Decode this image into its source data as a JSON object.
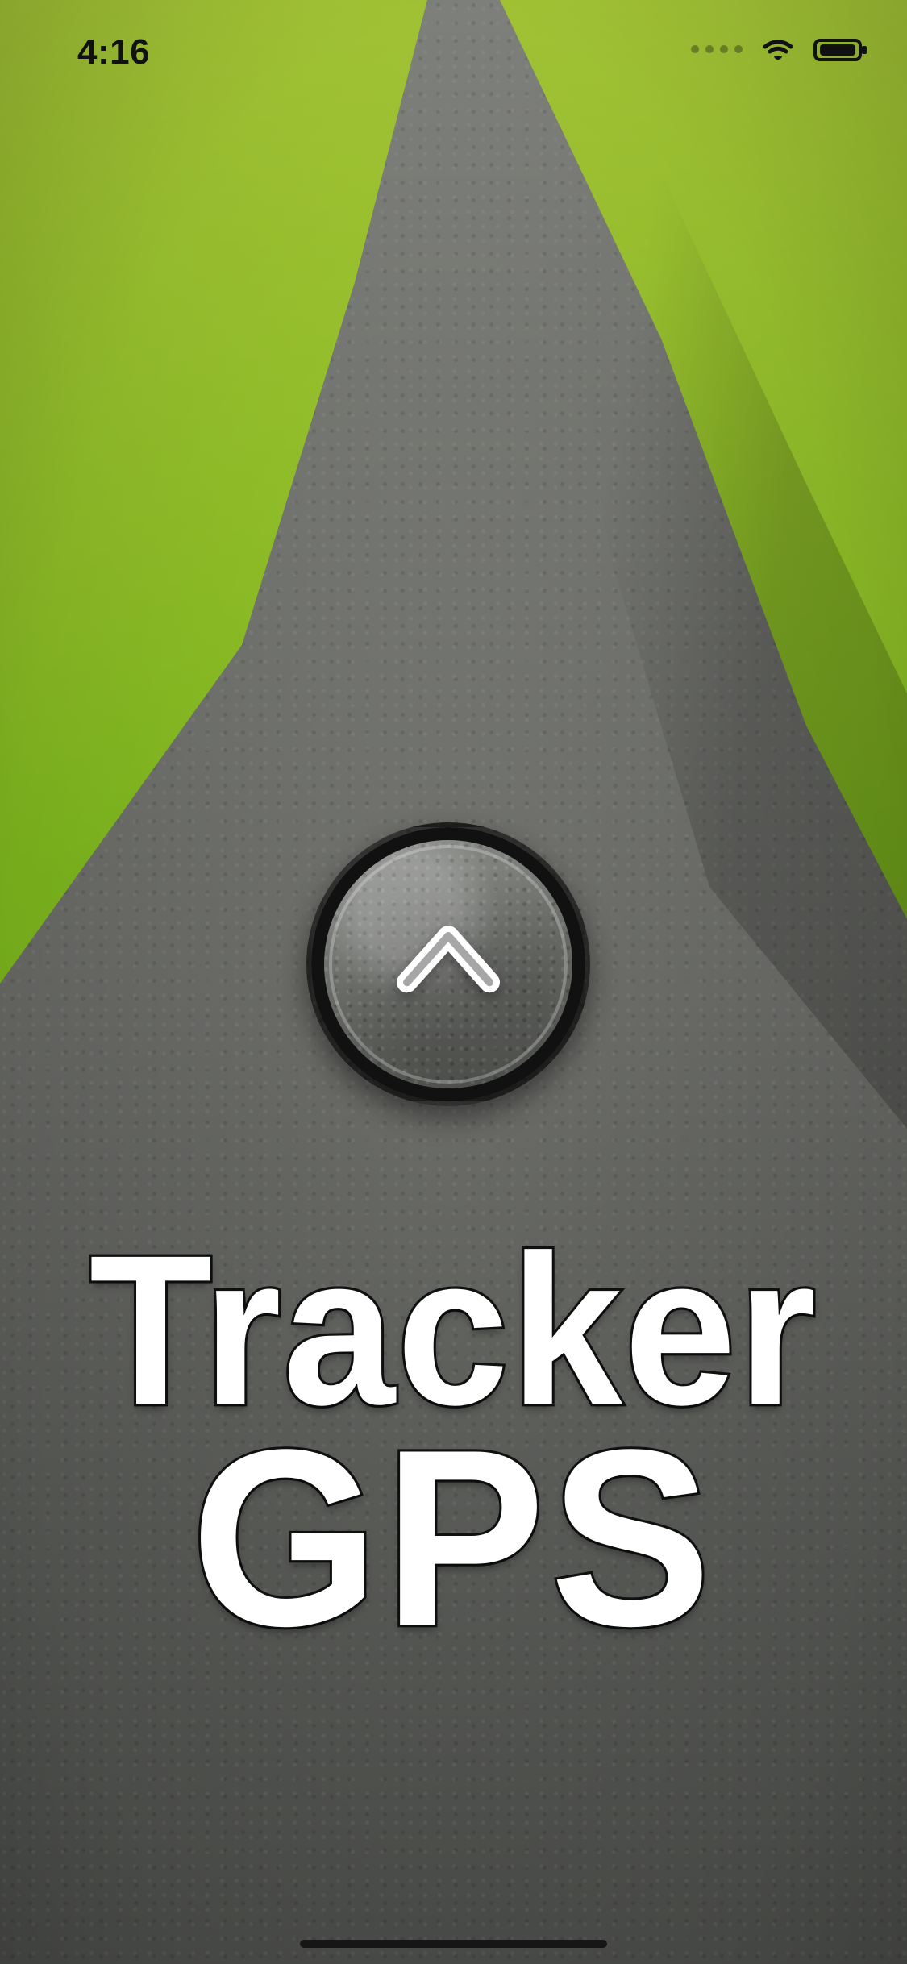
{
  "status_bar": {
    "time": "4:16",
    "icons": [
      "cellular-dots-icon",
      "wifi-icon",
      "battery-icon"
    ]
  },
  "center_action": {
    "icon": "chevron-up-icon"
  },
  "title": {
    "line1": "Tracker",
    "line2": "GPS"
  },
  "colors": {
    "title_fill": "#ffffff",
    "title_stroke": "#111111"
  }
}
